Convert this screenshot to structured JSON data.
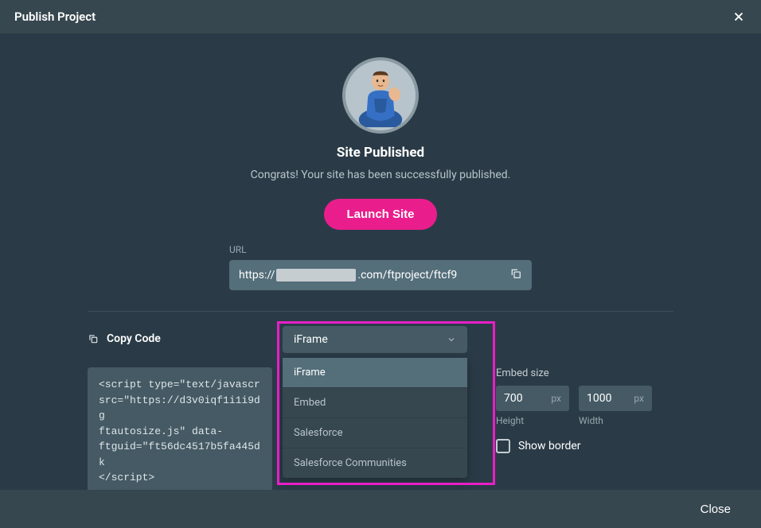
{
  "header": {
    "title": "Publish Project"
  },
  "main": {
    "heading": "Site Published",
    "subtext": "Congrats! Your site has been successfully published.",
    "launch_label": "Launch Site",
    "url_label": "URL",
    "url_prefix": "https://",
    "url_suffix": ".com/ftproject/ftcf9"
  },
  "embed": {
    "copy_code_label": "Copy Code",
    "select_value": "iFrame",
    "options": [
      "iFrame",
      "Embed",
      "Salesforce",
      "Salesforce Communities"
    ],
    "code_text": "<script type=\"text/javascr​src=\"https://d3v0iqf1i1i9dg​ftautosize.js\" data-ftguid=\"ft56dc4517b5fa445dk​</script>",
    "embed_size_label": "Embed size",
    "height_value": "700",
    "width_value": "1000",
    "unit": "px",
    "height_label": "Height",
    "width_label": "Width",
    "show_border_label": "Show border"
  },
  "footer": {
    "close_label": "Close"
  }
}
